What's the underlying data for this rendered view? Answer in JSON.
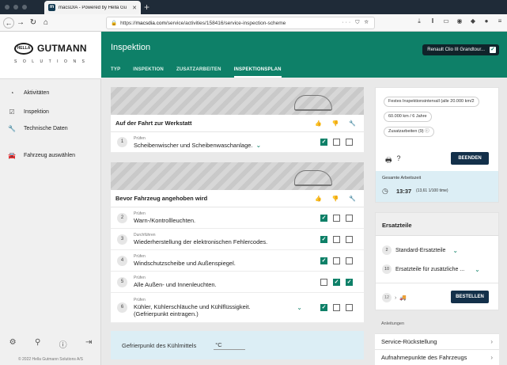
{
  "browser": {
    "tab_title": "macsDIA - Powered by Hella Gu",
    "url_prefix": "https://",
    "url_host": "macsdia.com",
    "url_path": "/service/activities/158416/service-inspection-scheme",
    "url_more": "··· ⛉ ☆"
  },
  "sidebar": {
    "logo_word": "HELLA",
    "logo_name": "GUTMANN",
    "logo_sub": "SOLUTIONS",
    "items": [
      {
        "label": "Aktivitäten",
        "icon": "gauge-icon"
      },
      {
        "label": "Inspektion",
        "icon": "checkbox-icon"
      },
      {
        "label": "Technische Daten",
        "icon": "wrench-icon"
      },
      {
        "label": "Fahrzeug auswählen",
        "icon": "car-icon"
      }
    ],
    "copyright": "© 2022 Hella Gutmann Solutions A/S"
  },
  "header": {
    "title": "Inspektion",
    "tabs": [
      "TYP",
      "INSPEKTION",
      "ZUSATZARBEITEN",
      "INSPEKTIONSPLAN"
    ],
    "active_tab": "INSPEKTIONSPLAN",
    "vehicle": "Renault Clio III Grandtour..."
  },
  "sections": [
    {
      "title": "Auf der Fahrt zur Werkstatt",
      "steps": [
        {
          "num": "1",
          "kind": "Prüfen",
          "text": "Scheibenwischer und Scheibenwaschanlage.",
          "state": [
            true,
            false,
            false
          ]
        }
      ]
    },
    {
      "title": "Bevor Fahrzeug angehoben wird",
      "steps": [
        {
          "num": "2",
          "kind": "Prüfen",
          "text": "Warn-/Kontrollleuchten.",
          "state": [
            true,
            false,
            false
          ]
        },
        {
          "num": "3",
          "kind": "Durchführen",
          "text": "Wiederherstellung der elektronischen Fehlercodes.",
          "state": [
            true,
            false,
            false
          ]
        },
        {
          "num": "4",
          "kind": "Prüfen",
          "text": "Windschutzscheibe und Außenspiegel.",
          "state": [
            true,
            false,
            false
          ]
        },
        {
          "num": "5",
          "kind": "Prüfen",
          "text": "Alle Außen- und Innenleuchten.",
          "state": [
            false,
            true,
            true
          ]
        },
        {
          "num": "6",
          "kind": "Prüfen",
          "text": "Kühler, Kühlerschläuche und Kühlflüssigkeit.",
          "text2": "(Gefrierpunkt eintragen.)",
          "state": [
            true,
            false,
            false
          ]
        }
      ]
    }
  ],
  "freeze": {
    "label": "Gefrierpunkt des Kühlmittels",
    "unit": "°C"
  },
  "info": {
    "pills": [
      "Festes Inspektionsintervall (alle 20.000 km/2",
      "60.000 km / 6 Jahre",
      "Zusatzarbeiten (9)"
    ],
    "end_label": "BEENDEN",
    "worktime_label": "Gesamte Arbeitszeit",
    "worktime_value": "13:37",
    "worktime_note": "(13,61 1/100 time)"
  },
  "parts": {
    "title": "Ersatzteile",
    "rows": [
      {
        "num": "2",
        "label": "Standard-Ersatzteile"
      },
      {
        "num": "10",
        "label": "Ersatzteile für zusätzliche ..."
      }
    ],
    "cart_count": "12",
    "order_label": "BESTELLEN"
  },
  "instructions": {
    "label": "Anleitungen",
    "items": [
      "Service-Rückstellung",
      "Aufnahmepunkte des Fahrzeugs"
    ]
  },
  "colors": {
    "accent": "#0e8068",
    "navy": "#13304a",
    "info_bg": "#dceef5"
  }
}
